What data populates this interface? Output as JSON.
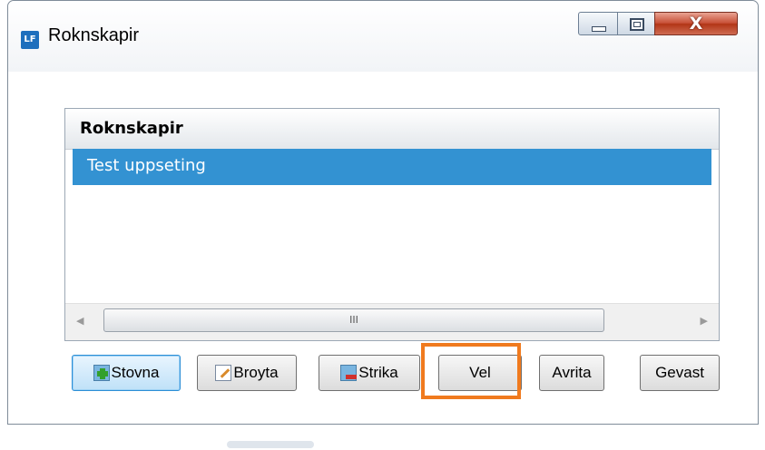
{
  "window": {
    "app_icon_text": "LF",
    "title": "Roknskapir",
    "minimize_glyph": "",
    "maximize_glyph": "",
    "close_glyph": "X"
  },
  "list": {
    "column_header": "Roknskapir",
    "rows": [
      {
        "label": "Test uppseting",
        "selected": true
      }
    ],
    "scrollbar": {
      "left_arrow": "◀",
      "right_arrow": "▶",
      "thumb_grip": "III"
    }
  },
  "buttons": {
    "add": "Stovna",
    "edit": "Broyta",
    "delete": "Strika",
    "select": "Vel",
    "cancel": "Avrita",
    "exit": "Gevast"
  },
  "icons": {
    "app": "app-logo-icon",
    "add": "add-icon",
    "edit": "edit-icon",
    "delete": "delete-icon"
  },
  "colors": {
    "selection": "#3392d2",
    "highlight": "#f07a1e",
    "close_button": "#c74f36"
  }
}
